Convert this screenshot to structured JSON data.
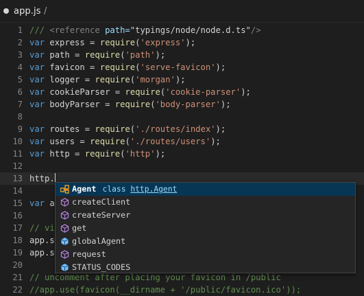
{
  "title": {
    "file_name": "app.js",
    "separator": "/"
  },
  "lines": [
    {
      "n": "1",
      "tokens": [
        [
          "cm",
          "/// "
        ],
        [
          "tag",
          "<reference "
        ],
        [
          "attr",
          "path="
        ],
        [
          "id",
          "\"typings/node/node.d.ts\""
        ],
        [
          "tag",
          "/>"
        ]
      ]
    },
    {
      "n": "2",
      "tokens": [
        [
          "kw",
          "var "
        ],
        [
          "id",
          "express = "
        ],
        [
          "fn",
          "require"
        ],
        [
          "id",
          "("
        ],
        [
          "str",
          "'express'"
        ],
        [
          "id",
          ");"
        ]
      ]
    },
    {
      "n": "3",
      "tokens": [
        [
          "kw",
          "var "
        ],
        [
          "id",
          "path = "
        ],
        [
          "fn",
          "require"
        ],
        [
          "id",
          "("
        ],
        [
          "str",
          "'path'"
        ],
        [
          "id",
          ");"
        ]
      ]
    },
    {
      "n": "4",
      "tokens": [
        [
          "kw",
          "var "
        ],
        [
          "id",
          "favicon = "
        ],
        [
          "fn",
          "require"
        ],
        [
          "id",
          "("
        ],
        [
          "str",
          "'serve-favicon'"
        ],
        [
          "id",
          ");"
        ]
      ]
    },
    {
      "n": "5",
      "tokens": [
        [
          "kw",
          "var "
        ],
        [
          "id",
          "logger = "
        ],
        [
          "fn",
          "require"
        ],
        [
          "id",
          "("
        ],
        [
          "str",
          "'morgan'"
        ],
        [
          "id",
          ");"
        ]
      ]
    },
    {
      "n": "6",
      "tokens": [
        [
          "kw",
          "var "
        ],
        [
          "id",
          "cookieParser = "
        ],
        [
          "fn",
          "require"
        ],
        [
          "id",
          "("
        ],
        [
          "str",
          "'cookie-parser'"
        ],
        [
          "id",
          ");"
        ]
      ]
    },
    {
      "n": "7",
      "tokens": [
        [
          "kw",
          "var "
        ],
        [
          "id",
          "bodyParser = "
        ],
        [
          "fn",
          "require"
        ],
        [
          "id",
          "("
        ],
        [
          "str",
          "'body-parser'"
        ],
        [
          "id",
          ");"
        ]
      ]
    },
    {
      "n": "8",
      "tokens": []
    },
    {
      "n": "9",
      "tokens": [
        [
          "kw",
          "var "
        ],
        [
          "id",
          "routes = "
        ],
        [
          "fn",
          "require"
        ],
        [
          "id",
          "("
        ],
        [
          "str",
          "'./routes/index'"
        ],
        [
          "id",
          ");"
        ]
      ]
    },
    {
      "n": "10",
      "tokens": [
        [
          "kw",
          "var "
        ],
        [
          "id",
          "users = "
        ],
        [
          "fn",
          "require"
        ],
        [
          "id",
          "("
        ],
        [
          "str",
          "'./routes/users'"
        ],
        [
          "id",
          ");"
        ]
      ]
    },
    {
      "n": "11",
      "tokens": [
        [
          "kw",
          "var "
        ],
        [
          "id",
          "http = "
        ],
        [
          "fn",
          "require"
        ],
        [
          "id",
          "("
        ],
        [
          "str",
          "'http'"
        ],
        [
          "id",
          ");"
        ]
      ]
    },
    {
      "n": "12",
      "tokens": []
    },
    {
      "n": "13",
      "tokens": [
        [
          "id",
          "http."
        ]
      ],
      "cursor": true
    },
    {
      "n": "14",
      "tokens": []
    },
    {
      "n": "15",
      "tokens": [
        [
          "kw",
          "var "
        ],
        [
          "id",
          "a"
        ]
      ]
    },
    {
      "n": "16",
      "tokens": []
    },
    {
      "n": "17",
      "tokens": [
        [
          "cm",
          "// vi"
        ]
      ]
    },
    {
      "n": "18",
      "tokens": [
        [
          "id",
          "app.s"
        ]
      ]
    },
    {
      "n": "19",
      "tokens": [
        [
          "id",
          "app.s"
        ]
      ]
    },
    {
      "n": "20",
      "tokens": []
    },
    {
      "n": "21",
      "tokens": [
        [
          "cm",
          "// uncomment after placing your favicon in /public"
        ]
      ]
    },
    {
      "n": "22",
      "tokens": [
        [
          "cm",
          "//app.use(favicon(__dirname + '/public/favicon.ico'));"
        ]
      ]
    }
  ],
  "suggest": {
    "items": [
      {
        "label": "Agent",
        "icon": "class-icon",
        "detail_kind": "class",
        "detail_type": "http.Agent",
        "selected": true
      },
      {
        "label": "createClient",
        "icon": "method-icon"
      },
      {
        "label": "createServer",
        "icon": "method-icon"
      },
      {
        "label": "get",
        "icon": "method-icon"
      },
      {
        "label": "globalAgent",
        "icon": "field-icon"
      },
      {
        "label": "request",
        "icon": "method-icon"
      },
      {
        "label": "STATUS_CODES",
        "icon": "field-icon"
      }
    ]
  },
  "colors": {
    "background": "#1e1e1e",
    "keyword": "#569cd6",
    "function": "#dcdcaa",
    "string": "#ce9178",
    "comment": "#608b4e",
    "method_icon": "#b180d7",
    "field_icon": "#75beff",
    "class_icon": "#ee9d28",
    "selection": "#073655"
  }
}
